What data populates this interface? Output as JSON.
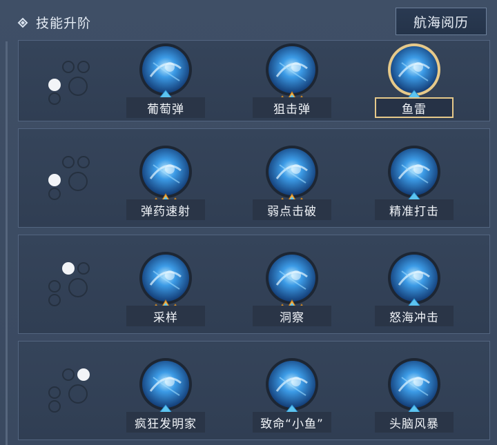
{
  "header": {
    "title": "技能升阶",
    "voyage_button": "航海阅历"
  },
  "rows": [
    {
      "active_dot": 0,
      "skills": [
        {
          "label": "葡萄弹",
          "icon": "grapeshot-skill-icon",
          "state": "normal"
        },
        {
          "label": "狙击弹",
          "icon": "sniper-shot-skill-icon",
          "state": "upgraded"
        },
        {
          "label": "鱼雷",
          "icon": "torpedo-skill-icon",
          "state": "selected"
        }
      ]
    },
    {
      "active_dot": 1,
      "skills": [
        {
          "label": "弹药速射",
          "icon": "rapid-fire-skill-icon",
          "state": "upgraded"
        },
        {
          "label": "弱点击破",
          "icon": "weakpoint-break-skill-icon",
          "state": "upgraded"
        },
        {
          "label": "精准打击",
          "icon": "precision-strike-skill-icon",
          "state": "normal"
        }
      ]
    },
    {
      "active_dot": 2,
      "skills": [
        {
          "label": "采样",
          "icon": "sampling-skill-icon",
          "state": "upgraded"
        },
        {
          "label": "洞察",
          "icon": "insight-skill-icon",
          "state": "upgraded"
        },
        {
          "label": "怒海冲击",
          "icon": "raging-sea-impact-skill-icon",
          "state": "normal"
        }
      ]
    },
    {
      "active_dot": 3,
      "skills": [
        {
          "label": "疯狂发明家",
          "icon": "mad-inventor-skill-icon",
          "state": "normal"
        },
        {
          "label": "致命“小鱼”",
          "icon": "deadly-little-fish-skill-icon",
          "state": "normal"
        },
        {
          "label": "头脑风暴",
          "icon": "brainstorm-skill-icon",
          "state": "normal"
        }
      ]
    }
  ],
  "colors": {
    "gold": "#f2b34a",
    "selected_border": "#e6c98a",
    "icon_blue": "#2f7fd4",
    "marker_blue": "#5cc4f0"
  }
}
